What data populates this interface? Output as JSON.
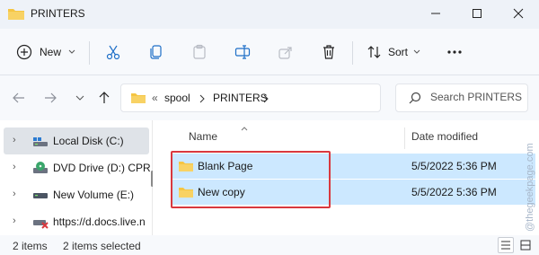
{
  "window": {
    "title": "PRINTERS"
  },
  "toolbar": {
    "new_label": "New",
    "sort_label": "Sort"
  },
  "address": {
    "segments": [
      "spool",
      "PRINTERS"
    ]
  },
  "search": {
    "placeholder": "Search PRINTERS"
  },
  "sidebar": {
    "items": [
      {
        "label": "Local Disk (C:)",
        "icon": "drive-icon",
        "selected": true
      },
      {
        "label": "DVD Drive (D:) CPR",
        "icon": "dvd-icon",
        "selected": false
      },
      {
        "label": "New Volume (E:)",
        "icon": "drive-icon",
        "selected": false
      },
      {
        "label": "https://d.docs.live.n",
        "icon": "network-drive-icon",
        "selected": false
      }
    ]
  },
  "columns": {
    "name": "Name",
    "date": "Date modified"
  },
  "files": [
    {
      "name": "Blank Page",
      "date": "5/5/2022 5:36 PM"
    },
    {
      "name": "New copy",
      "date": "5/5/2022 5:36 PM"
    }
  ],
  "status": {
    "count": "2 items",
    "selected": "2 items selected"
  },
  "watermark": "@thegeekpage.com",
  "colors": {
    "selection": "#cce8ff",
    "highlight_box": "#d9383e",
    "folder": "#f5c542"
  }
}
